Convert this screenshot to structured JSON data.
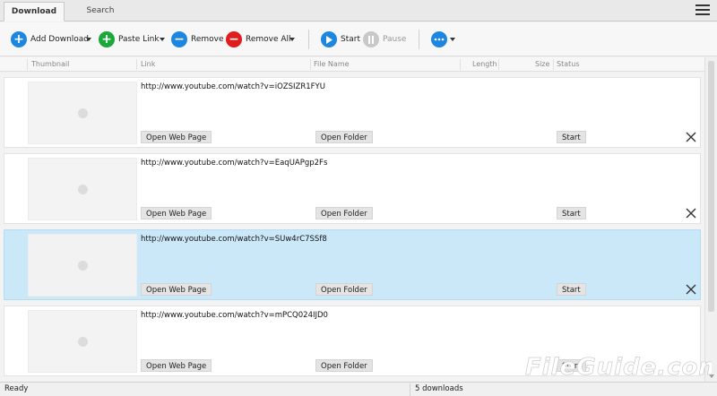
{
  "tabs": [
    {
      "label": "Download"
    },
    {
      "label": "Search"
    }
  ],
  "toolbar": {
    "add_download": "Add Download",
    "paste_link": "Paste Link",
    "remove": "Remove",
    "remove_all": "Remove All",
    "start": "Start",
    "pause": "Pause"
  },
  "columns": {
    "thumbnail": "Thumbnail",
    "link": "Link",
    "file_name": "File Name",
    "length": "Length",
    "size": "Size",
    "status": "Status"
  },
  "rows": [
    {
      "link": "http://www.youtube.com/watch?v=iOZSIZR1FYU",
      "open_web": "Open Web Page",
      "open_folder": "Open Folder",
      "start": "Start"
    },
    {
      "link": "http://www.youtube.com/watch?v=EaqUAPgp2Fs",
      "open_web": "Open Web Page",
      "open_folder": "Open Folder",
      "start": "Start"
    },
    {
      "link": "http://www.youtube.com/watch?v=SUw4rC7SSf8",
      "open_web": "Open Web Page",
      "open_folder": "Open Folder",
      "start": "Start"
    },
    {
      "link": "http://www.youtube.com/watch?v=mPCQ024IJD0",
      "open_web": "Open Web Page",
      "open_folder": "Open Folder",
      "start": "Start"
    }
  ],
  "status": {
    "left": "Ready",
    "count": "5 downloads"
  },
  "watermark": "FileGuide.com",
  "colors": {
    "accent_blue": "#1c86e0",
    "green": "#1aa83a",
    "red": "#e01c1c",
    "selected_row": "#cbe8f8"
  },
  "icons": {
    "add": "plus-circle-icon",
    "paste": "plus-circle-icon",
    "remove": "minus-circle-icon",
    "remove_all": "minus-circle-icon",
    "start": "play-circle-icon",
    "pause": "pause-circle-icon",
    "more": "more-circle-icon",
    "menu": "hamburger-icon",
    "close": "close-icon"
  }
}
